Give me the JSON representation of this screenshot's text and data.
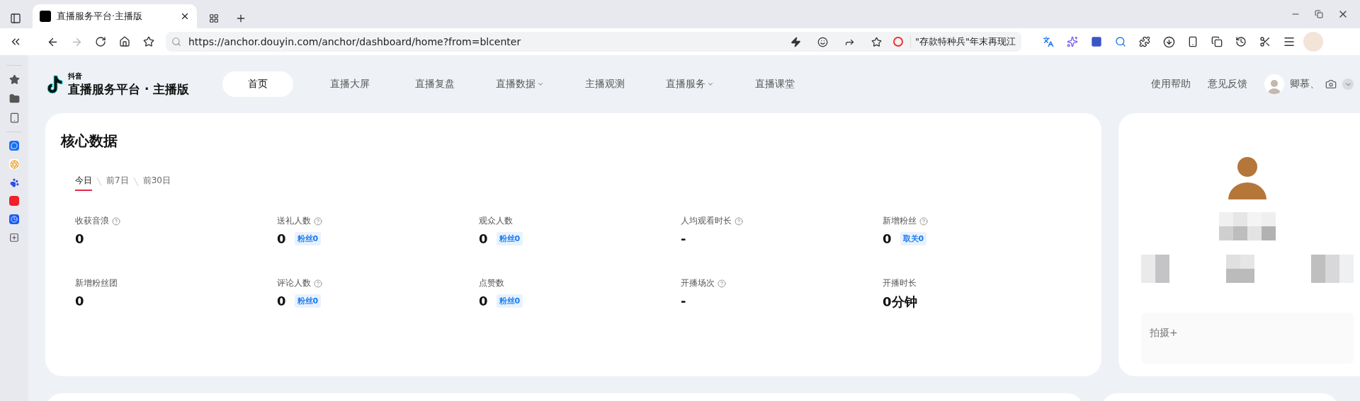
{
  "browser": {
    "tabs": [
      {
        "title": "直播服务平台·主播版",
        "selected": true
      }
    ],
    "url": "https://anchor.douyin.com/anchor/dashboard/home?from=blcenter",
    "search_hint": "\"存款特种兵\"年末再现江"
  },
  "header": {
    "brand_small": "抖音",
    "brand": "直播服务平台 · 主播版",
    "nav": [
      {
        "label": "首页",
        "selected": true,
        "dropdown": false
      },
      {
        "label": "直播大屏",
        "selected": false,
        "dropdown": false
      },
      {
        "label": "直播复盘",
        "selected": false,
        "dropdown": false
      },
      {
        "label": "直播数据",
        "selected": false,
        "dropdown": true
      },
      {
        "label": "主播观测",
        "selected": false,
        "dropdown": false
      },
      {
        "label": "直播服务",
        "selected": false,
        "dropdown": true
      },
      {
        "label": "直播课堂",
        "selected": false,
        "dropdown": false
      }
    ],
    "links": [
      "使用帮助",
      "意见反馈"
    ],
    "user_name": "卿慕、"
  },
  "core_data": {
    "title": "核心数据",
    "periods": [
      {
        "label": "今日",
        "selected": true
      },
      {
        "label": "前7日",
        "selected": false
      },
      {
        "label": "前30日",
        "selected": false
      }
    ],
    "metrics": [
      {
        "label": "收获音浪",
        "help": true,
        "value": "0"
      },
      {
        "label": "送礼人数",
        "help": true,
        "value": "0",
        "tag": "粉丝0"
      },
      {
        "label": "观众人数",
        "help": false,
        "value": "0",
        "tag": "粉丝0"
      },
      {
        "label": "人均观看时长",
        "help": true,
        "value": "-"
      },
      {
        "label": "新增粉丝",
        "help": true,
        "value": "0",
        "tag": "取关0"
      },
      {
        "label": "新增粉丝团",
        "help": false,
        "value": "0"
      },
      {
        "label": "评论人数",
        "help": true,
        "value": "0",
        "tag": "粉丝0"
      },
      {
        "label": "点赞数",
        "help": false,
        "value": "0",
        "tag": "粉丝0"
      },
      {
        "label": "开播场次",
        "help": true,
        "value": "-"
      },
      {
        "label": "开播时长",
        "help": false,
        "value": "0分钟"
      }
    ]
  },
  "profile": {
    "shoot_button": "拍摄+"
  }
}
